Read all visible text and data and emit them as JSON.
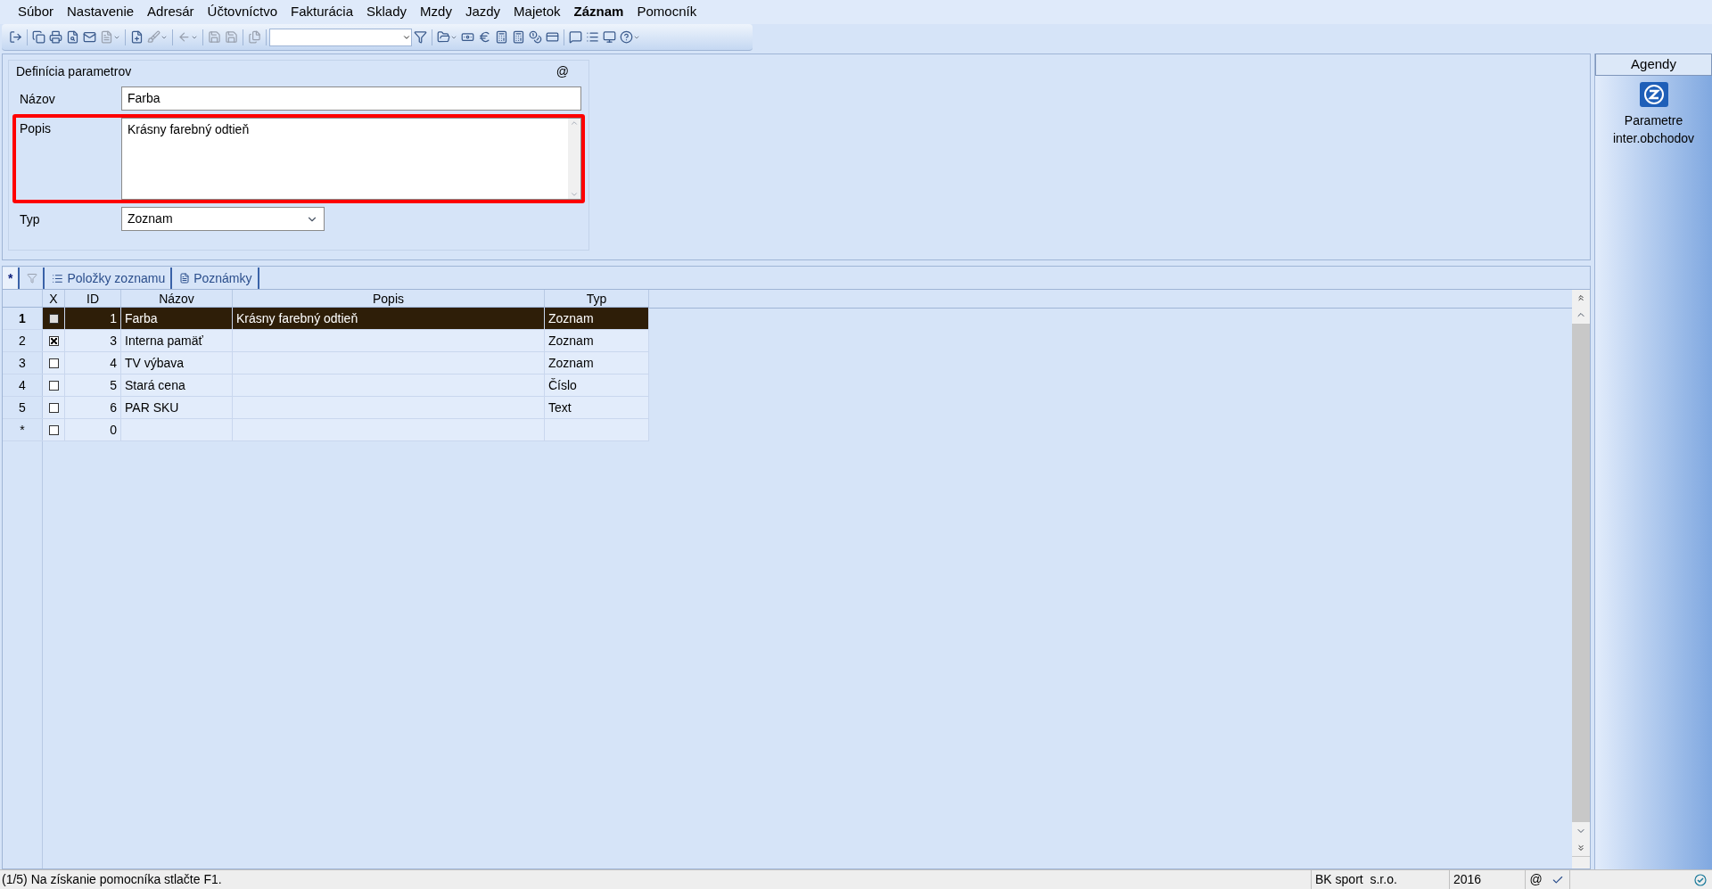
{
  "menu": [
    {
      "label": "Súbor",
      "selected": false
    },
    {
      "label": "Nastavenie",
      "selected": false
    },
    {
      "label": "Adresár",
      "selected": false
    },
    {
      "label": "Účtovníctvo",
      "selected": false
    },
    {
      "label": "Fakturácia",
      "selected": false
    },
    {
      "label": "Sklady",
      "selected": false
    },
    {
      "label": "Mzdy",
      "selected": false
    },
    {
      "label": "Jazdy",
      "selected": false
    },
    {
      "label": "Majetok",
      "selected": false
    },
    {
      "label": "Záznam",
      "selected": true
    },
    {
      "label": "Pomocník",
      "selected": false
    }
  ],
  "form": {
    "title": "Definícia parametrov",
    "corner": "@",
    "fields": [
      {
        "label": "Názov",
        "kind": "text",
        "value": "Farba",
        "highlighted": false
      },
      {
        "label": "Popis",
        "kind": "textarea",
        "value": "Krásny farebný odtieň",
        "highlighted": true
      },
      {
        "label": "Typ",
        "kind": "select",
        "value": "Zoznam",
        "highlighted": false
      }
    ]
  },
  "tabs": [
    {
      "label": "*",
      "kind": "new",
      "selected": true
    },
    {
      "kind": "filter",
      "selected": false
    },
    {
      "label": "Položky zoznamu",
      "kind": "list",
      "selected": false
    },
    {
      "label": "Poznámky",
      "kind": "notes",
      "selected": false
    }
  ],
  "table": {
    "columns": [
      "X",
      "ID",
      "Názov",
      "Popis",
      "Typ"
    ],
    "rows": [
      {
        "number": "1",
        "checked": false,
        "id": "1",
        "name": "Farba",
        "description": "Krásny farebný odtieň",
        "type": "Zoznam",
        "selected": true
      },
      {
        "number": "2",
        "checked": true,
        "id": "3",
        "name": "Interna pamäť",
        "type": "Zoznam",
        "selected": false
      },
      {
        "number": "3",
        "checked": false,
        "id": "4",
        "name": "TV výbava",
        "type": "Zoznam",
        "selected": false
      },
      {
        "number": "4",
        "checked": false,
        "id": "5",
        "name": "Stará cena",
        "type": "Číslo",
        "selected": false
      },
      {
        "number": "5",
        "checked": false,
        "id": "6",
        "name": "PAR SKU",
        "type": "Text",
        "selected": false
      },
      {
        "number": "*",
        "checked": false,
        "id": "0",
        "selected": false
      }
    ]
  },
  "sidebar": {
    "title": "Agendy",
    "items": [
      {
        "label": "Parametre inter.obchodov"
      }
    ]
  },
  "status_bar": {
    "message": "(1/5) Na získanie pomocníka stlačte F1.",
    "company": "BK sport  s.r.o.",
    "year": "2016",
    "at": "@"
  }
}
